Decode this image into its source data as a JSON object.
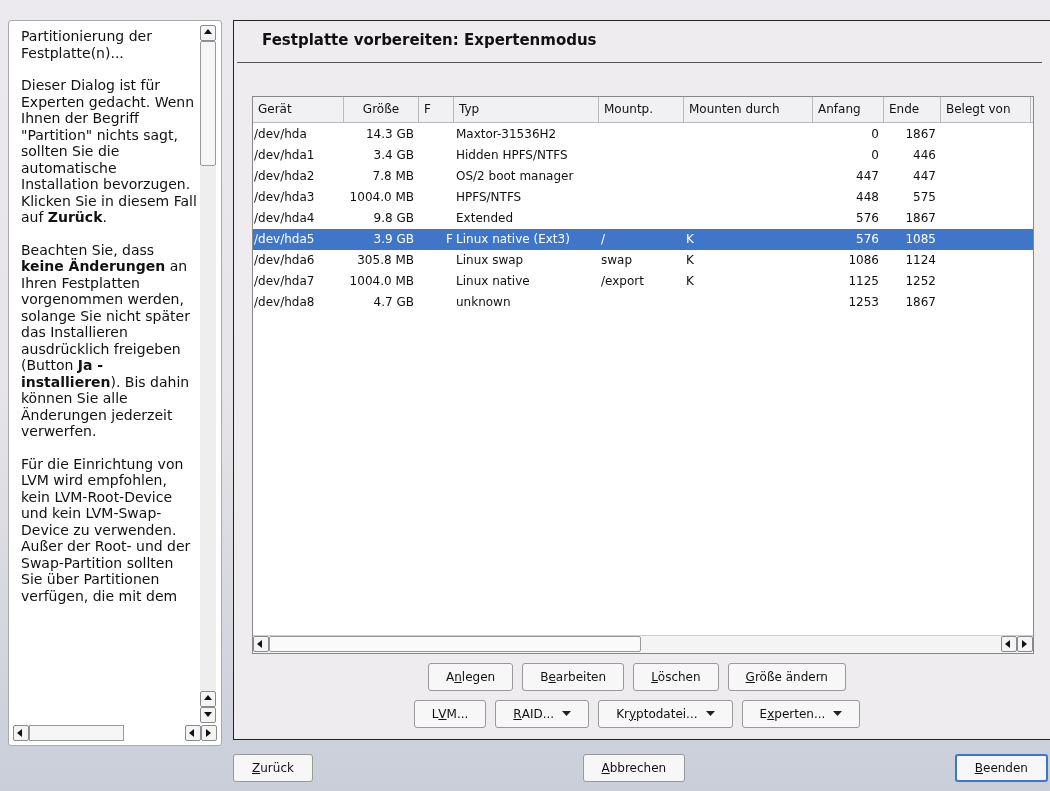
{
  "help": {
    "paragraphs": [
      "Partitionierung der Festplatte(n)...",
      "Dieser Dialog ist für Experten gedacht. Wenn Ihnen der Begriff \"Partition\" nichts sagt, sollten Sie die automatische Installation bevorzugen. Klicken Sie in diesem Fall auf **Zurück**.",
      "Beachten Sie, dass **keine Änderungen** an Ihren Festplatten vorgenommen werden, solange Sie nicht später das Installieren ausdrücklich freigeben (Button **Ja - installieren**). Bis dahin können Sie alle Änderungen jederzeit verwerfen.",
      "Für die Einrichtung von LVM wird empfohlen, kein LVM-Root-Device und kein LVM-Swap-Device zu verwenden. Außer der Root- und der Swap-Partition sollten Sie über Partitionen verfügen, die mit dem"
    ]
  },
  "title": "Festplatte vorbereiten: Expertenmodus",
  "table": {
    "columns": [
      "Gerät",
      "Größe",
      "F",
      "Typ",
      "Mountp.",
      "Mounten durch",
      "Anfang",
      "Ende",
      "Belegt von"
    ],
    "rows": [
      {
        "cells": [
          "/dev/hda",
          "14.3 GB",
          "",
          "Maxtor-31536H2",
          "",
          "",
          "0",
          "1867"
        ],
        "selected": false
      },
      {
        "cells": [
          "/dev/hda1",
          "3.4 GB",
          "",
          "Hidden HPFS/NTFS",
          "",
          "",
          "0",
          "446"
        ],
        "selected": false
      },
      {
        "cells": [
          "/dev/hda2",
          "7.8 MB",
          "",
          "OS/2 boot manager",
          "",
          "",
          "447",
          "447"
        ],
        "selected": false
      },
      {
        "cells": [
          "/dev/hda3",
          "1004.0 MB",
          "",
          "HPFS/NTFS",
          "",
          "",
          "448",
          "575"
        ],
        "selected": false
      },
      {
        "cells": [
          "/dev/hda4",
          "9.8 GB",
          "",
          "Extended",
          "",
          "",
          "576",
          "1867"
        ],
        "selected": false
      },
      {
        "cells": [
          "/dev/hda5",
          "3.9 GB",
          "F",
          "Linux native (Ext3)",
          "/",
          "K",
          "576",
          "1085"
        ],
        "selected": true
      },
      {
        "cells": [
          "/dev/hda6",
          "305.8 MB",
          "",
          "Linux swap",
          "swap",
          "K",
          "1086",
          "1124"
        ],
        "selected": false
      },
      {
        "cells": [
          "/dev/hda7",
          "1004.0 MB",
          "",
          "Linux native",
          "/export",
          "K",
          "1125",
          "1252"
        ],
        "selected": false
      },
      {
        "cells": [
          "/dev/hda8",
          "4.7 GB",
          "",
          "unknown",
          "",
          "",
          "1253",
          "1867"
        ],
        "selected": false
      }
    ]
  },
  "actions": [
    [
      {
        "pre": "A",
        "key": "n",
        "post": "legen",
        "menu": false
      },
      {
        "pre": "B",
        "key": "e",
        "post": "arbeiten",
        "menu": false
      },
      {
        "key": "L",
        "post": "öschen",
        "menu": false
      },
      {
        "key": "G",
        "post": "röße ändern",
        "menu": false
      }
    ],
    [
      {
        "pre": "L",
        "key": "V",
        "post": "M...",
        "menu": false
      },
      {
        "key": "R",
        "post": "AID...",
        "menu": true
      },
      {
        "pre": "Kr",
        "key": "y",
        "post": "ptodatei...",
        "menu": true
      },
      {
        "pre": "E",
        "key": "x",
        "post": "perten...",
        "menu": true
      }
    ]
  ],
  "footer": [
    {
      "key": "Z",
      "post": "urück",
      "default": false
    },
    {
      "key": "A",
      "post": "bbrechen",
      "default": false
    },
    {
      "key": "B",
      "post": "eenden",
      "default": true
    }
  ]
}
